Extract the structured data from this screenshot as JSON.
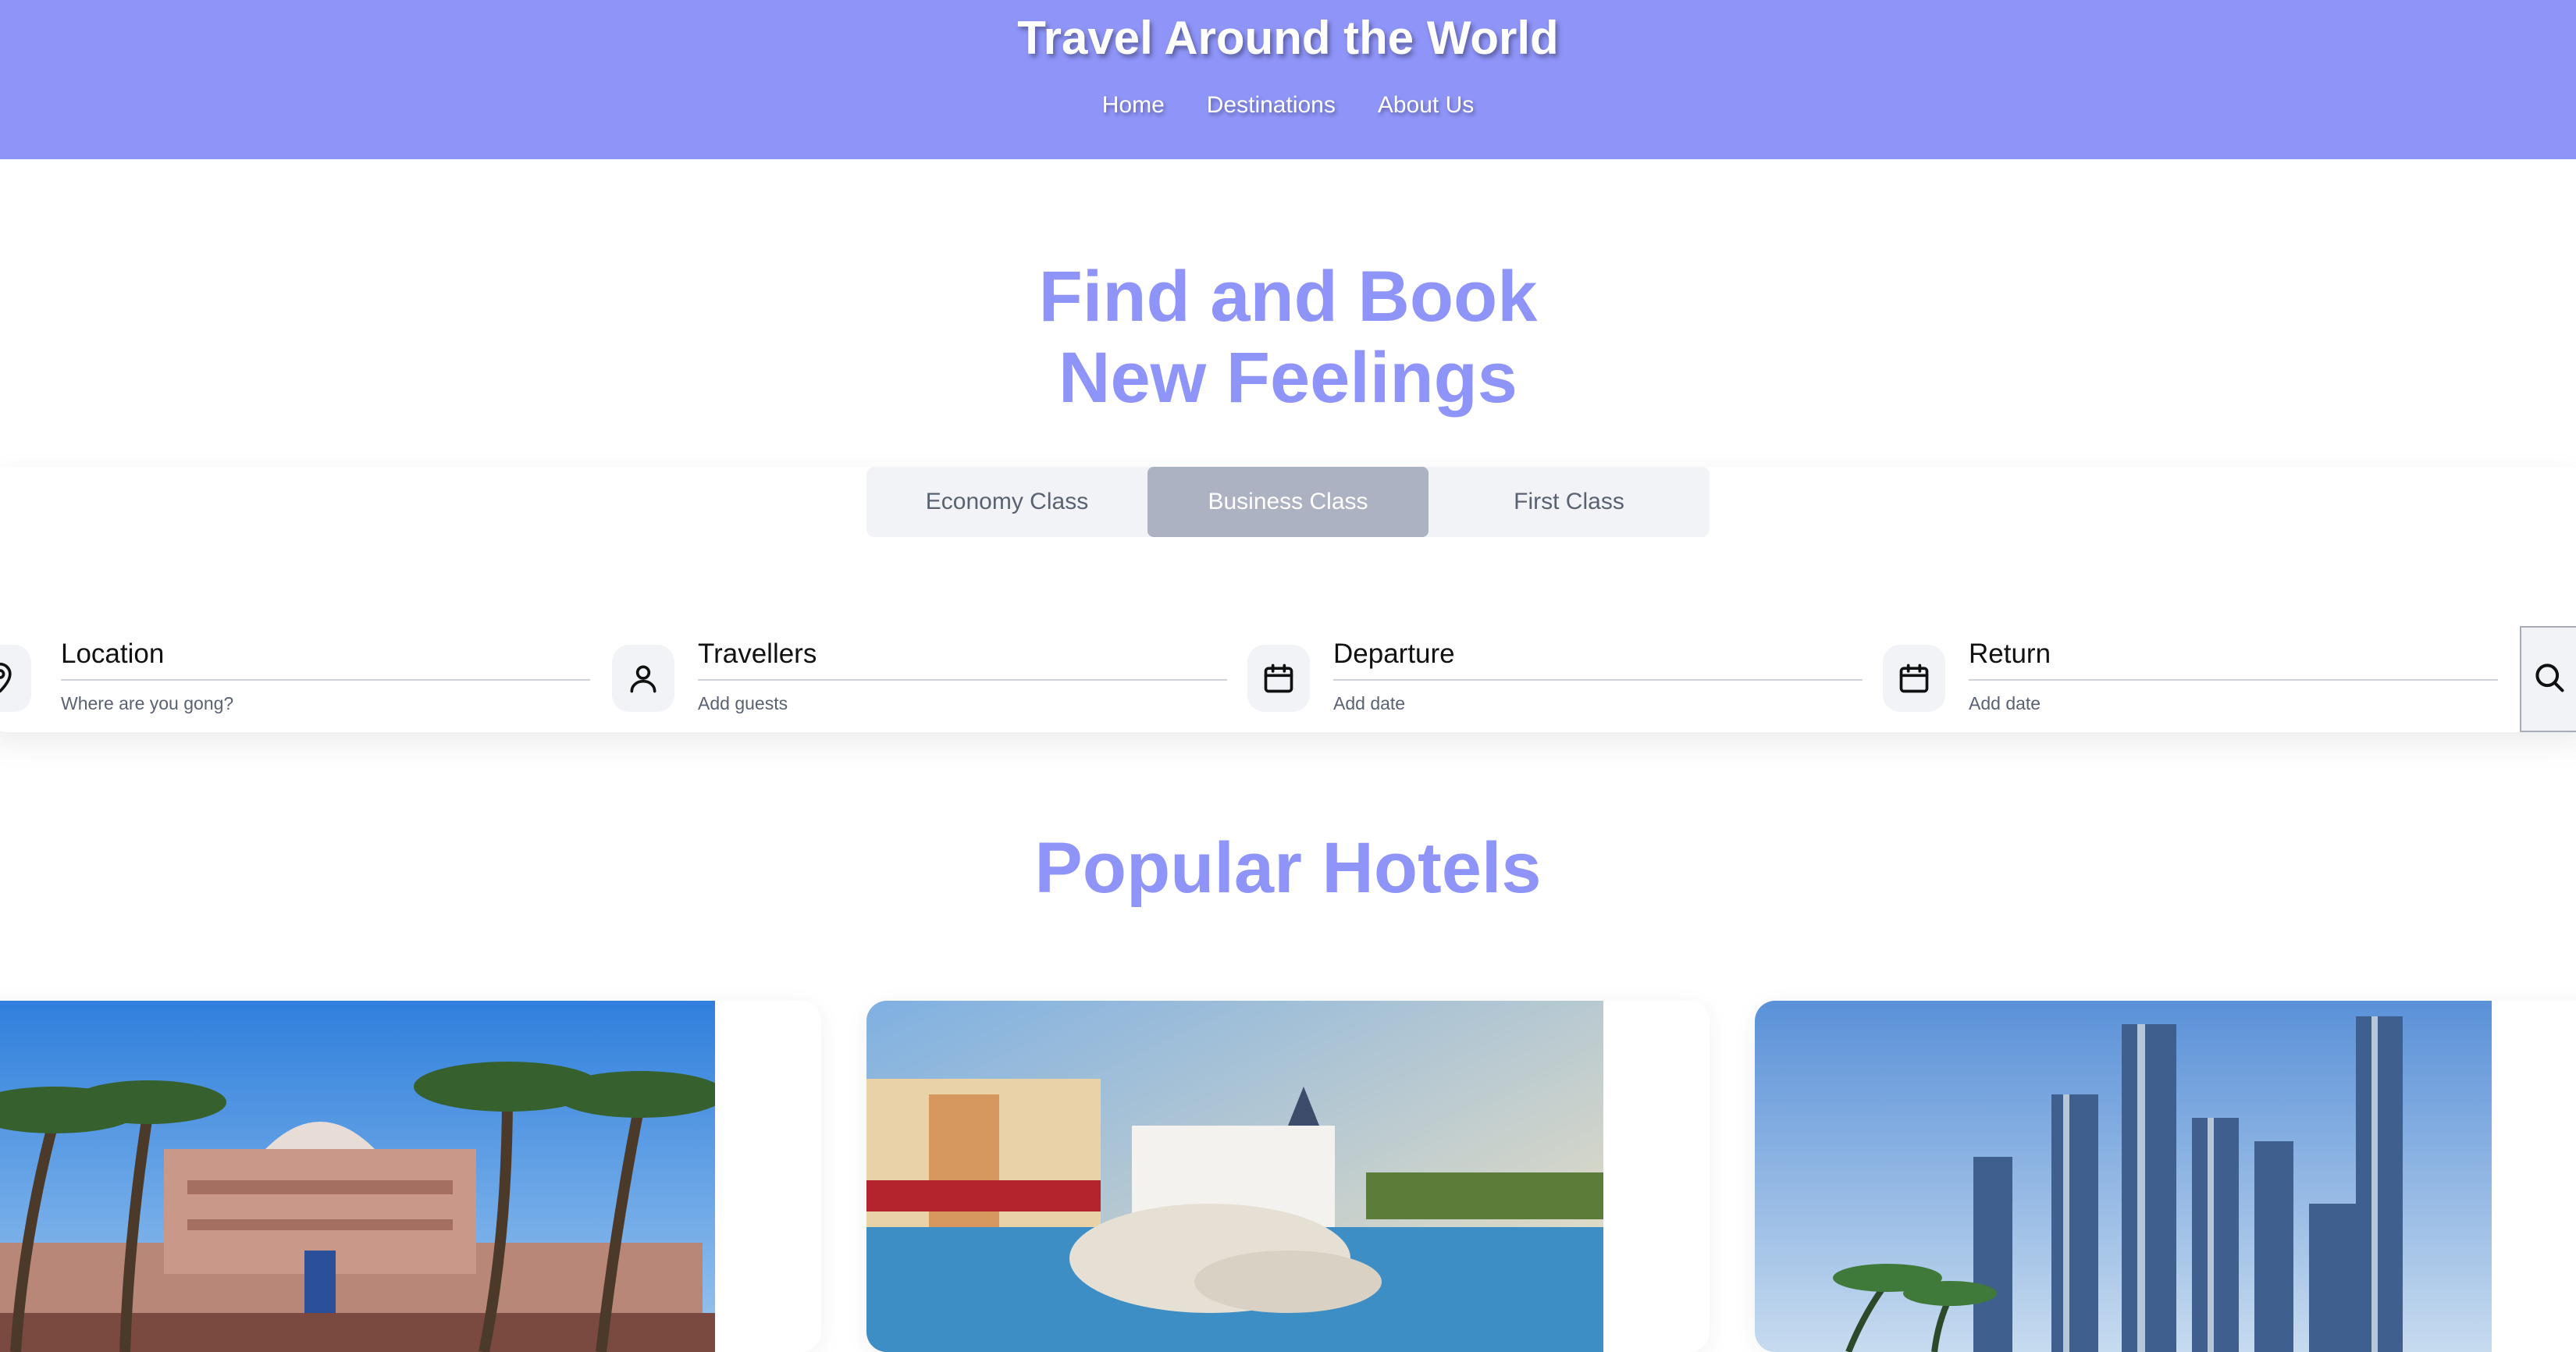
{
  "header": {
    "title": "Travel Around the World",
    "nav": [
      {
        "label": "Home"
      },
      {
        "label": "Destinations"
      },
      {
        "label": "About Us"
      }
    ]
  },
  "hero": {
    "title_line1": "Find and Book",
    "title_line2": "New Feelings"
  },
  "booking": {
    "classes": [
      {
        "label": "Economy Class",
        "active": false
      },
      {
        "label": "Business Class",
        "active": true
      },
      {
        "label": "First Class",
        "active": false
      }
    ],
    "fields": {
      "location": {
        "label": "Location",
        "hint": "Where are you gong?",
        "icon": "map-pin-icon"
      },
      "travellers": {
        "label": "Travellers",
        "hint": "Add guests",
        "icon": "user-icon"
      },
      "departure": {
        "label": "Departure",
        "hint": "Add date",
        "icon": "calendar-icon"
      },
      "return": {
        "label": "Return",
        "hint": "Add date",
        "icon": "calendar-icon"
      }
    },
    "search_icon": "search-icon"
  },
  "popular": {
    "title": "Popular Hotels",
    "hotels": [
      {
        "image": "palace-with-palm-trees"
      },
      {
        "image": "resort-with-pool"
      },
      {
        "image": "city-skyscrapers"
      }
    ]
  },
  "colors": {
    "accent": "#8e94f8",
    "tab_active": "#adb2c3",
    "tab_bg": "#f1f3f7",
    "muted_text": "#5a6272"
  }
}
